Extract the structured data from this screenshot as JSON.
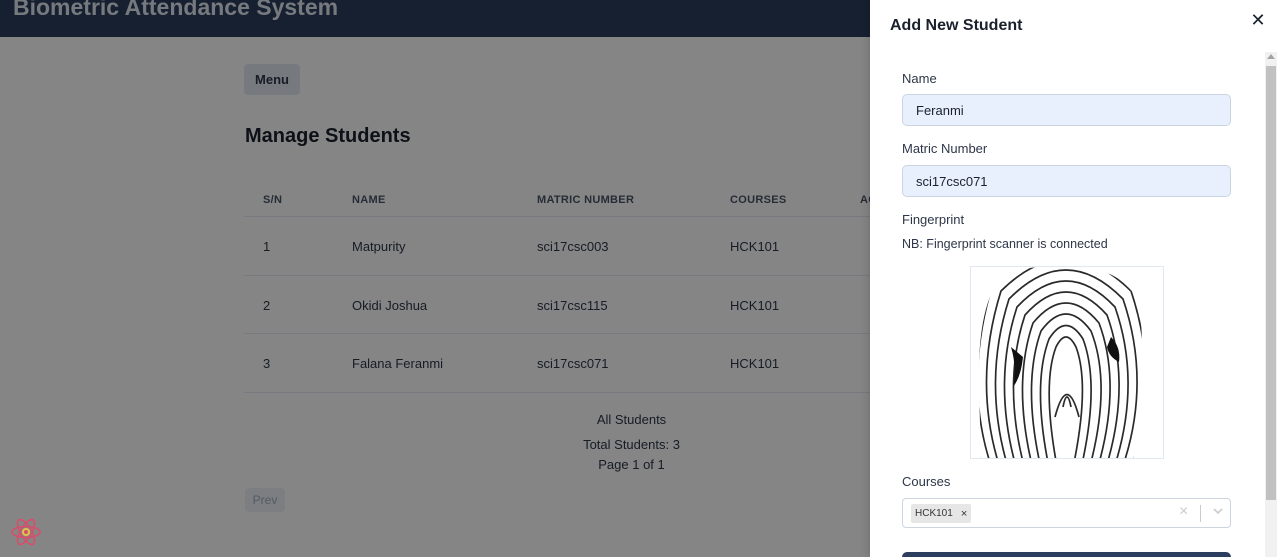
{
  "app": {
    "title": "Biometric Attendance System"
  },
  "page": {
    "menu_label": "Menu",
    "title": "Manage Students",
    "table": {
      "headers": [
        "S/N",
        "NAME",
        "MATRIC NUMBER",
        "COURSES",
        "AC"
      ],
      "rows": [
        {
          "sn": "1",
          "name": "Matpurity",
          "matric": "sci17csc003",
          "courses": "HCK101"
        },
        {
          "sn": "2",
          "name": "Okidi Joshua",
          "matric": "sci17csc115",
          "courses": "HCK101"
        },
        {
          "sn": "3",
          "name": "Falana Feranmi",
          "matric": "sci17csc071",
          "courses": "HCK101"
        }
      ]
    },
    "footer": {
      "all_label": "All Students",
      "total": "Total Students: 3",
      "page_info": "Page 1 of 1"
    },
    "prev_label": "Prev"
  },
  "drawer": {
    "title": "Add New Student",
    "name_label": "Name",
    "name_value": "Feranmi",
    "matric_label": "Matric Number",
    "matric_value": "sci17csc071",
    "fingerprint_label": "Fingerprint",
    "fingerprint_note": "NB: Fingerprint scanner is connected",
    "courses_label": "Courses",
    "selected_courses": [
      "HCK101"
    ]
  },
  "colors": {
    "header_bg": "#2c3e5e",
    "input_bg": "#e8f0fe",
    "overlay": "rgba(0,0,0,0.48)",
    "react_logo": "#d64f6a"
  },
  "icons": [
    "close-icon",
    "remove-tag-icon",
    "clear-icon",
    "chevron-down-icon",
    "react-logo-icon"
  ]
}
